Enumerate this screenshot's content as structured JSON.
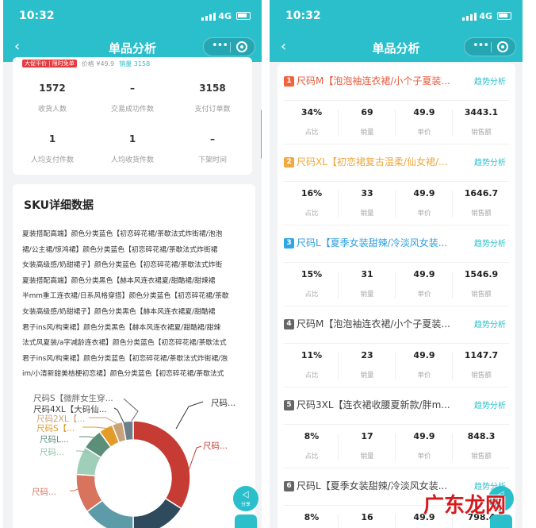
{
  "left": {
    "status": {
      "time": "10:32",
      "network": "4G"
    },
    "nav": {
      "title": "单品分析",
      "back_icon": "chevron-left-icon"
    },
    "peek": {
      "tag": "大促平价 | 限时免单",
      "price": "价格 ¥49.9",
      "sales": "销量 3158"
    },
    "stats": [
      {
        "value": "1572",
        "label": "收货人数"
      },
      {
        "value": "–",
        "label": "交易成功件数"
      },
      {
        "value": "3158",
        "label": "支付订单数"
      },
      {
        "value": "1",
        "label": "人均支付件数"
      },
      {
        "value": "1",
        "label": "人均收货件数"
      },
      {
        "value": "–",
        "label": "下架时间"
      }
    ],
    "sku_title": "SKU详细数据",
    "sku_lines": [
      "夏装搭配高端】颜色分类蓝色【初恋碎花裙/茶歇法式炸街裙/泡泡",
      "裙/公主裙/惊鸿裙】颜色分类蓝色【初恋碎花裙/茶歇法式炸街裙",
      "女装高级感/奶甜裙子】颜色分类蓝色【初恋碎花裙/茶歇法式炸街",
      "夏装搭配高端】颜色分类黑色【赫本风连衣裙夏/甜酷裙/甜辣裙",
      "半mm重工连衣裙/日系风格穿搭】颜色分类蓝色【初恋碎花裙/茶歇",
      "女装高级感/奶甜裙子】颜色分类黑色【赫本风连衣裙夏/甜酷裙",
      "君子ins风/构束裙】颜色分类黑色【赫本风连衣裙夏/甜酷裙/甜辣",
      "法式风夏装/a字减龄连衣裙】颜色分类蓝色【初恋碎花裙/茶歇法式",
      "君子ins风/构束裙】颜色分类蓝色【初恋碎花裙/茶歇法式炸街裙/泡",
      "im/小清新甜美桔梗初恋裙】颜色分类蓝色【初恋碎花裙/茶歇法式"
    ],
    "pie_labels": [
      {
        "text": "尺码S【微胖女生穿...",
        "color": "#666666"
      },
      {
        "text": "尺码4XL【大码仙...",
        "color": "#444444"
      },
      {
        "text": "尺码2XL【...",
        "color": "#c9a27a"
      },
      {
        "text": "尺码S【...",
        "color": "#e39b2a"
      },
      {
        "text": "尺码L...",
        "color": "#5b8f7a"
      },
      {
        "text": "尺码...",
        "color": "#8fc1a8"
      },
      {
        "text": "尺码...",
        "color": "#d8735e"
      },
      {
        "text": "尺码...",
        "color": "#333333"
      },
      {
        "text": "尺码...",
        "color": "#c0392b"
      }
    ],
    "pie": [
      {
        "value": 34,
        "color": "#c63b33"
      },
      {
        "value": 16,
        "color": "#2e4a5c"
      },
      {
        "value": 15,
        "color": "#5d9ba8"
      },
      {
        "value": 11,
        "color": "#d8735e"
      },
      {
        "value": 8,
        "color": "#9fcfb8"
      },
      {
        "value": 6,
        "color": "#5b8f7a"
      },
      {
        "value": 4,
        "color": "#e39b2a"
      },
      {
        "value": 3,
        "color": "#c9a27a"
      },
      {
        "value": 3,
        "color": "#6e7f8a"
      }
    ],
    "share_label": "分享"
  },
  "right": {
    "status": {
      "time": "10:32",
      "network": "4G"
    },
    "nav": {
      "title": "单品分析"
    },
    "trend_label": "趋势分析",
    "col_labels": [
      "占比",
      "销量",
      "单价",
      "销售额"
    ],
    "items": [
      {
        "rank": "1",
        "name": "尺码M【泡泡袖连衣裙/小个子夏装...",
        "color": "#e8593c",
        "rank_color": "#f2623e",
        "values": [
          "34%",
          "69",
          "49.9",
          "3443.1"
        ]
      },
      {
        "rank": "2",
        "name": "尺码XL【初恋裙复古温柔/仙女裙/...",
        "color": "#f0a53b",
        "rank_color": "#f3a93e",
        "values": [
          "16%",
          "33",
          "49.9",
          "1646.7"
        ]
      },
      {
        "rank": "3",
        "name": "尺码L【夏季女装甜辣/冷淡风女装...",
        "color": "#2c9fe0",
        "rank_color": "#2fa6e6",
        "values": [
          "15%",
          "31",
          "49.9",
          "1546.9"
        ]
      },
      {
        "rank": "4",
        "name": "尺码M【泡泡袖连衣裙/小个子夏装...",
        "color": "#444444",
        "rank_color": "#666666",
        "values": [
          "11%",
          "23",
          "49.9",
          "1147.7"
        ]
      },
      {
        "rank": "5",
        "name": "尺码3XL【连衣裙收腰夏新款/胖m...",
        "color": "#444444",
        "rank_color": "#666666",
        "values": [
          "8%",
          "17",
          "49.9",
          "848.3"
        ]
      },
      {
        "rank": "6",
        "name": "尺码L【夏季女装甜辣/冷淡风女装...",
        "color": "#444444",
        "rank_color": "#666666",
        "values": [
          "8%",
          "16",
          "49.9",
          "798.4"
        ]
      }
    ]
  },
  "watermark": "广东龙网"
}
